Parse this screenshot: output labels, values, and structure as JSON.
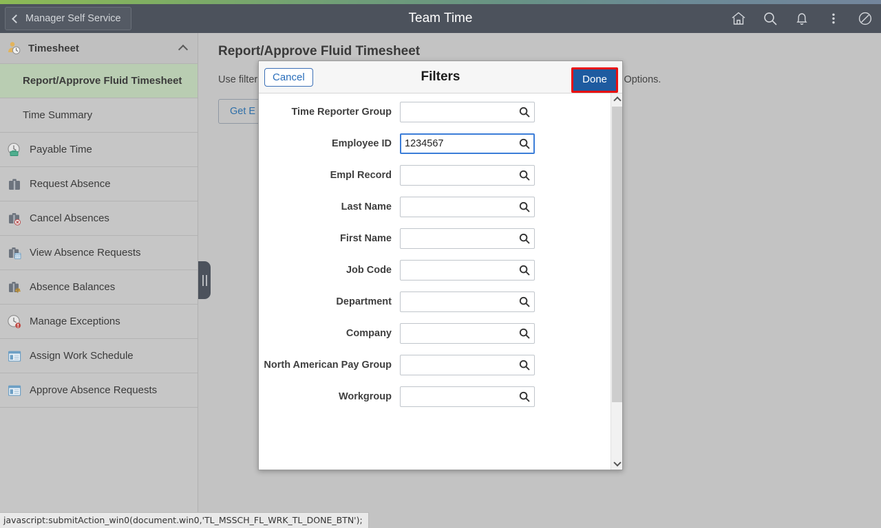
{
  "header": {
    "back_label": "Manager Self Service",
    "title": "Team Time",
    "icons": [
      {
        "name": "home-icon",
        "label": "Home"
      },
      {
        "name": "search-icon",
        "label": "Search"
      },
      {
        "name": "notifications-icon",
        "label": "Notifications"
      },
      {
        "name": "actions-menu-icon",
        "label": "Actions"
      },
      {
        "name": "nav-bar-icon",
        "label": "NavBar"
      }
    ]
  },
  "sidebar": {
    "group_title": "Timesheet",
    "group_icon": "person-clock-icon",
    "items": [
      {
        "label": "Report/Approve Fluid Timesheet",
        "icon": "",
        "selected": true,
        "sub": true
      },
      {
        "label": "Time Summary",
        "icon": "",
        "selected": false,
        "sub": true
      },
      {
        "label": "Payable Time",
        "icon": "clock-money-icon",
        "selected": false,
        "sub": false
      },
      {
        "label": "Request Absence",
        "icon": "briefcase-icon",
        "selected": false,
        "sub": false
      },
      {
        "label": "Cancel Absences",
        "icon": "briefcase-cancel-icon",
        "selected": false,
        "sub": false
      },
      {
        "label": "View Absence Requests",
        "icon": "briefcase-calendar-icon",
        "selected": false,
        "sub": false
      },
      {
        "label": "Absence Balances",
        "icon": "briefcase-balance-icon",
        "selected": false,
        "sub": false
      },
      {
        "label": "Manage Exceptions",
        "icon": "clock-alert-icon",
        "selected": false,
        "sub": false
      },
      {
        "label": "Assign Work Schedule",
        "icon": "window-panel-icon",
        "selected": false,
        "sub": false
      },
      {
        "label": "Approve Absence Requests",
        "icon": "window-panel-icon",
        "selected": false,
        "sub": false
      }
    ],
    "collapse_handle": "collapse-sidebar-handle"
  },
  "main": {
    "page_title": "Report/Approve Fluid Timesheet",
    "instructions_left": "Use filter",
    "instructions_right": "rch Options.",
    "get_button_label": "Get E"
  },
  "modal": {
    "title": "Filters",
    "cancel_label": "Cancel",
    "done_label": "Done",
    "done_focus_color": "#e8100f",
    "done_bg_color": "#1e5ba0",
    "fields": [
      {
        "label": "Time Reporter Group",
        "value": "",
        "focused": false
      },
      {
        "label": "Employee ID",
        "value": "1234567",
        "focused": true
      },
      {
        "label": "Empl Record",
        "value": "",
        "focused": false
      },
      {
        "label": "Last Name",
        "value": "",
        "focused": false
      },
      {
        "label": "First Name",
        "value": "",
        "focused": false
      },
      {
        "label": "Job Code",
        "value": "",
        "focused": false
      },
      {
        "label": "Department",
        "value": "",
        "focused": false
      },
      {
        "label": "Company",
        "value": "",
        "focused": false
      },
      {
        "label": "North American Pay Group",
        "value": "",
        "focused": false
      },
      {
        "label": "Workgroup",
        "value": "",
        "focused": false
      }
    ]
  },
  "statusbar": {
    "text": "javascript:submitAction_win0(document.win0,'TL_MSSCH_FL_WRK_TL_DONE_BTN');"
  }
}
